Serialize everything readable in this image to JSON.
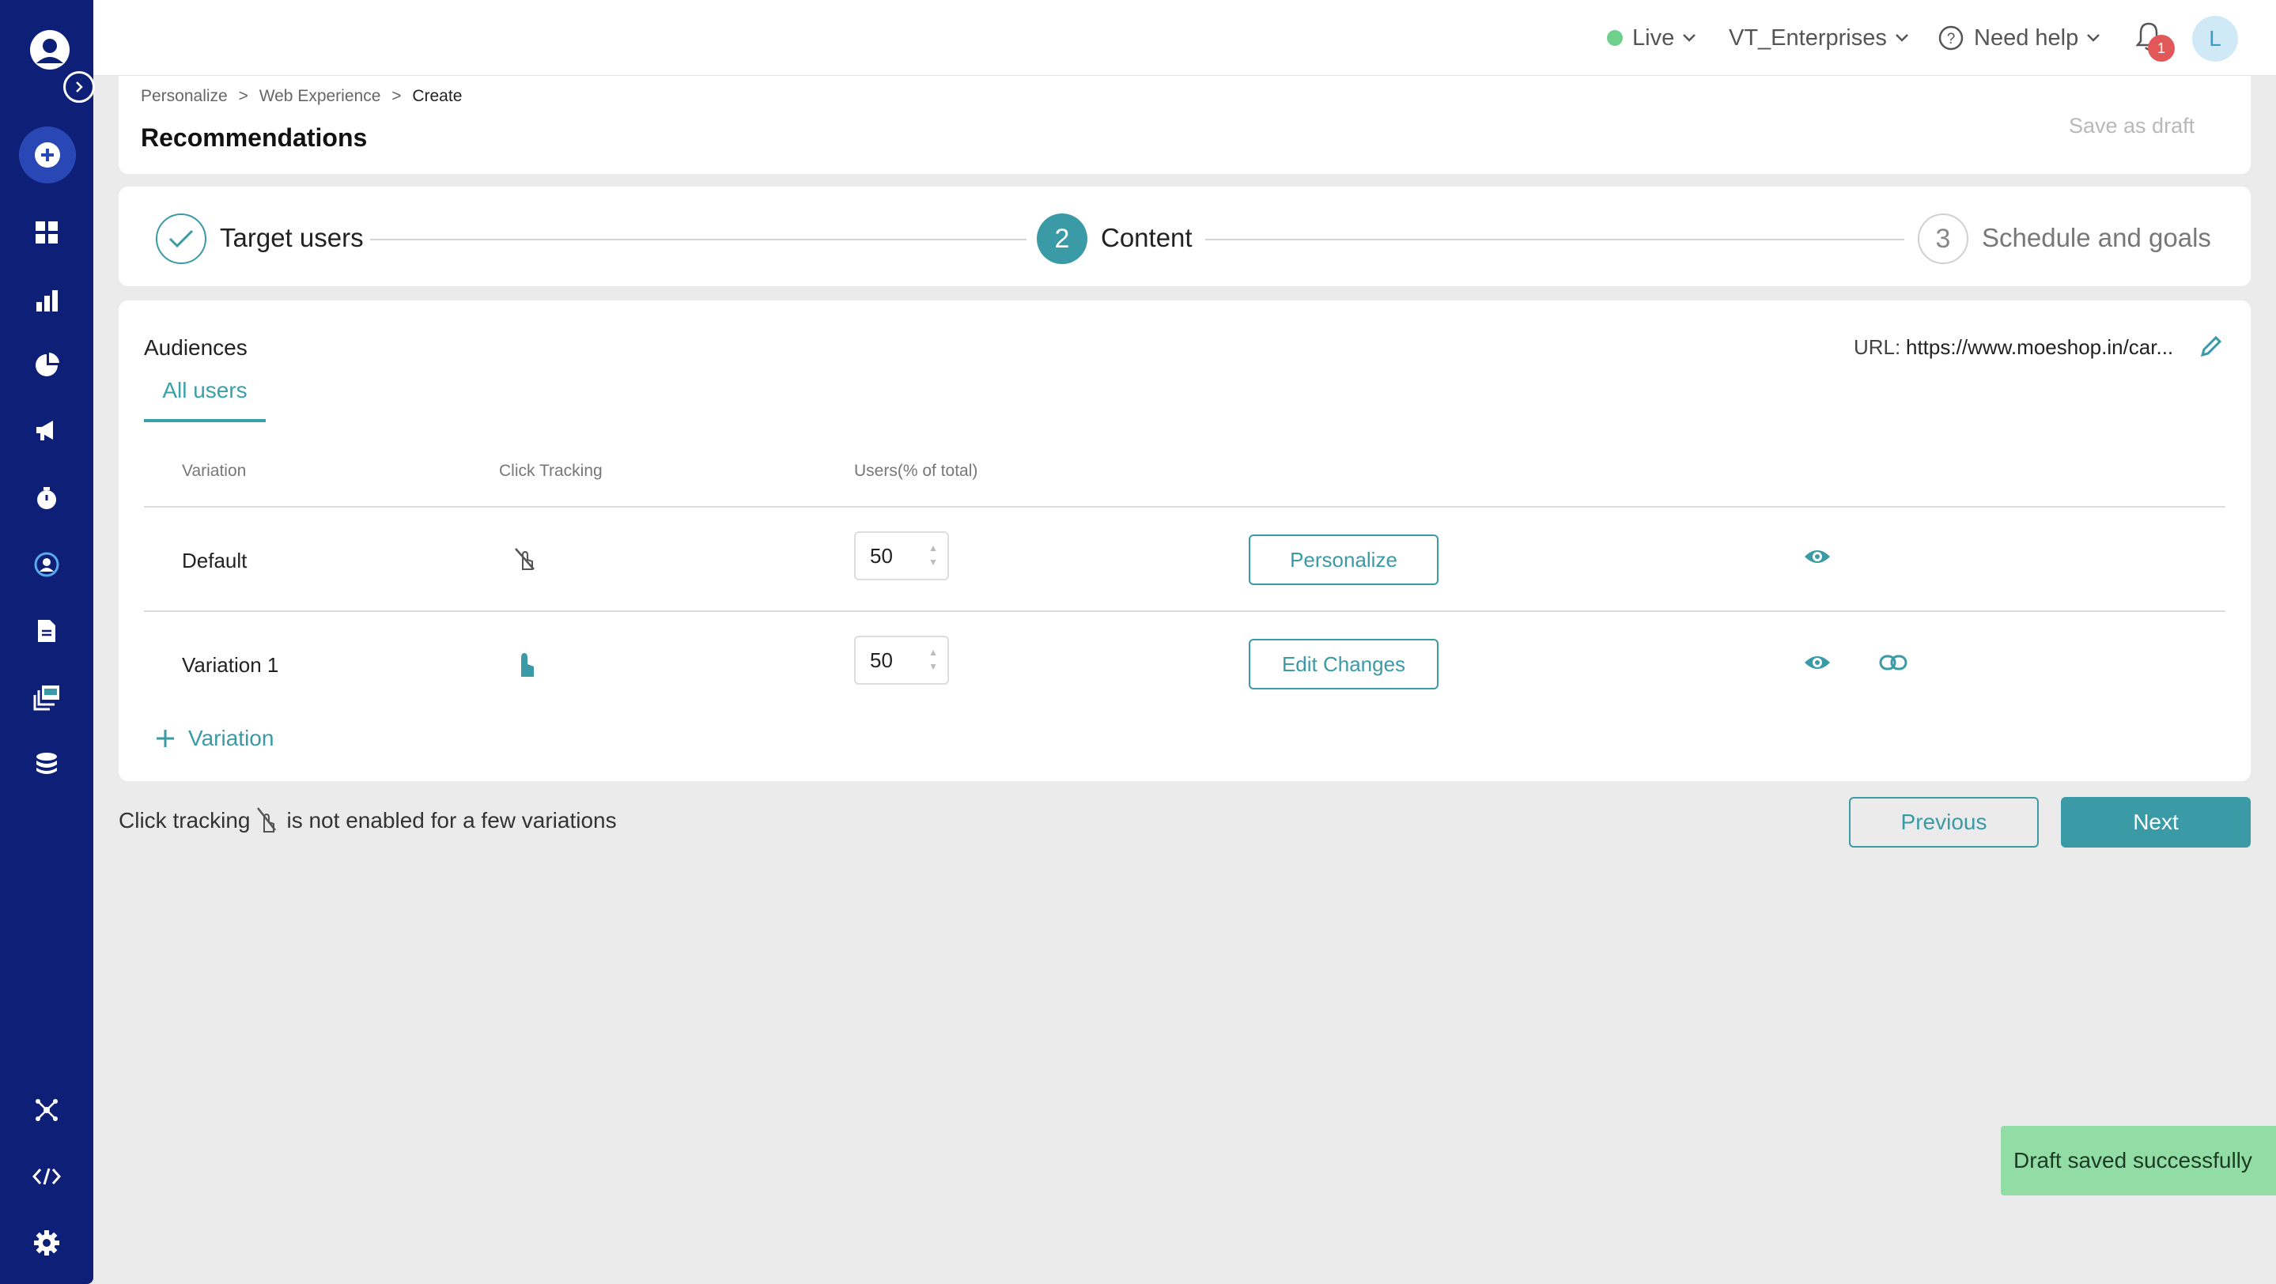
{
  "topbar": {
    "status": "Live",
    "workspace": "VT_Enterprises",
    "help": "Need help",
    "notification_count": "1",
    "avatar_initial": "L"
  },
  "header": {
    "breadcrumb": [
      "Personalize",
      "Web Experience",
      "Create"
    ],
    "separator": ">",
    "title": "Recommendations",
    "save_draft": "Save as draft"
  },
  "stepper": {
    "steps": [
      {
        "number": "1",
        "label": "Target users",
        "state": "done"
      },
      {
        "number": "2",
        "label": "Content",
        "state": "active"
      },
      {
        "number": "3",
        "label": "Schedule and goals",
        "state": "pending"
      }
    ]
  },
  "content": {
    "audiences_label": "Audiences",
    "tab": "All users",
    "url_label": "URL:",
    "url_value": "https://www.moeshop.in/car...",
    "columns": [
      "Variation",
      "Click Tracking",
      "Users(% of total)"
    ],
    "rows": [
      {
        "name": "Default",
        "click_tracking": false,
        "users": "50",
        "action": "Personalize"
      },
      {
        "name": "Variation 1",
        "click_tracking": true,
        "users": "50",
        "action": "Edit Changes"
      }
    ],
    "add_variation": "Variation"
  },
  "footer": {
    "note_prefix": "Click tracking",
    "note_suffix": "is not enabled for a few variations",
    "previous": "Previous",
    "next": "Next"
  },
  "toast": "Draft saved successfully",
  "colors": {
    "sidebar": "#0d1f77",
    "accent": "#3a9aa6",
    "toast": "#92dda6",
    "live": "#6fd08c",
    "badge": "#e25757"
  }
}
